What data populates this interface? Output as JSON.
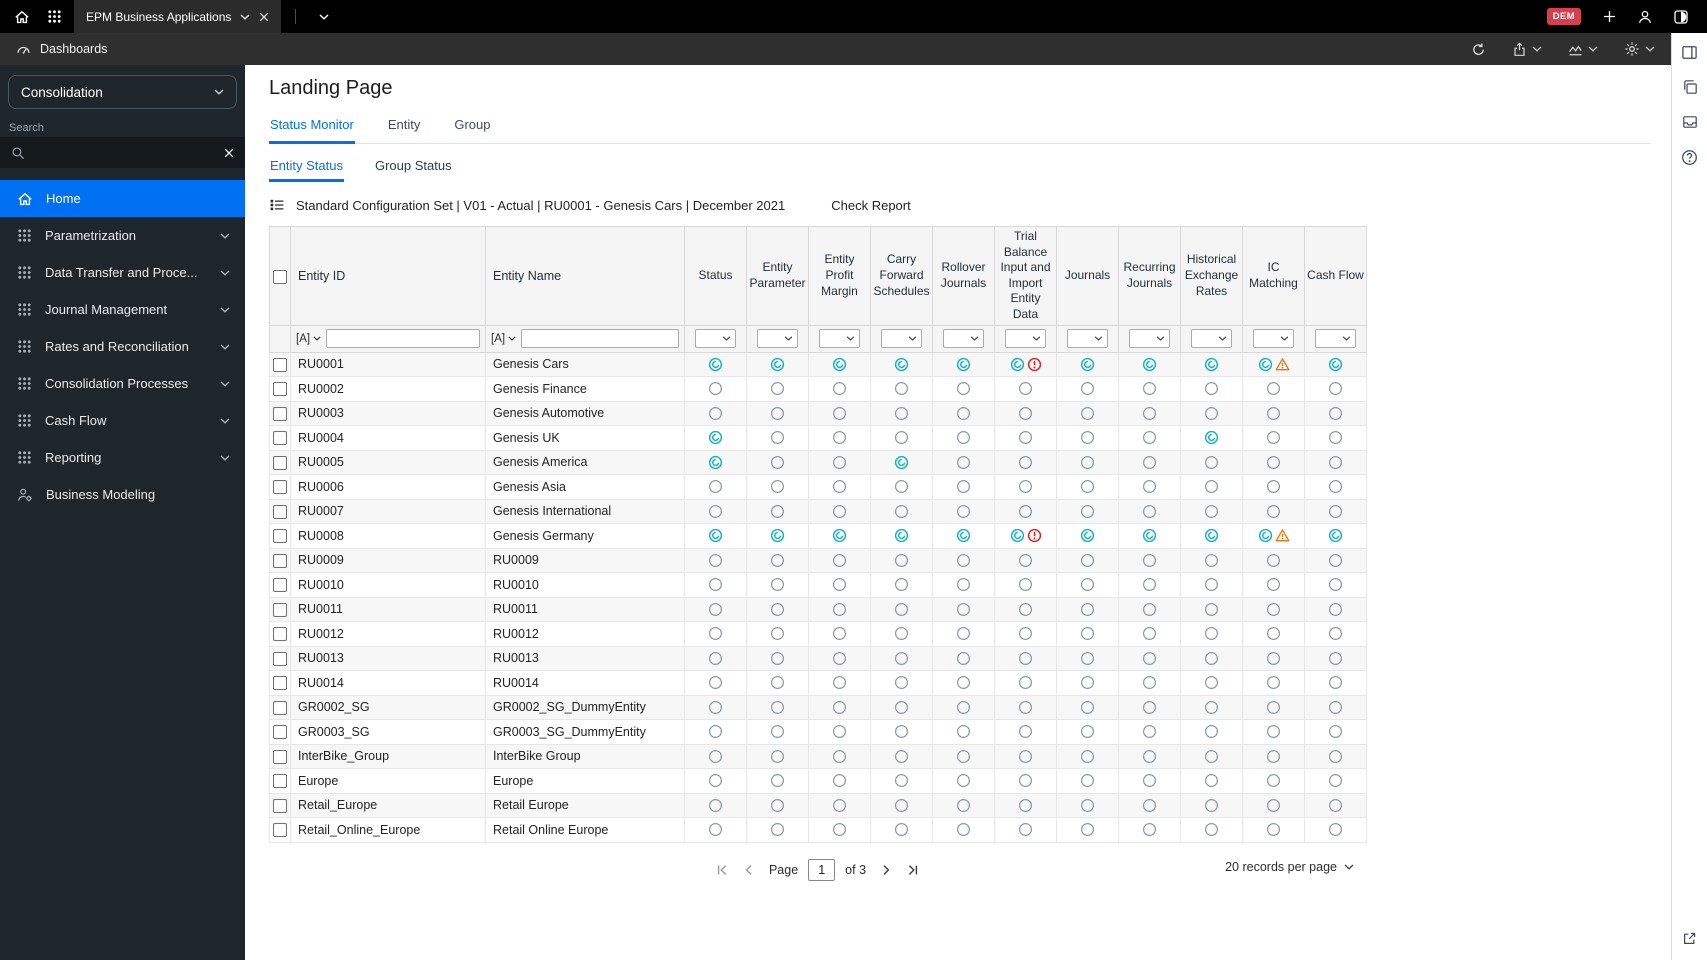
{
  "topbar": {
    "tab_label": "EPM Business Applications",
    "badge": "DEM"
  },
  "subbar": {
    "title": "Dashboards",
    "actions": [
      {
        "icon": "refresh",
        "chevron": false
      },
      {
        "icon": "share",
        "chevron": true
      },
      {
        "icon": "insights",
        "chevron": true
      },
      {
        "icon": "settings",
        "chevron": true
      }
    ]
  },
  "right_rail": {
    "top_icons": [
      "panel-layout",
      "copy",
      "inbox",
      "help"
    ],
    "bottom_icon": "open-external"
  },
  "sidebar": {
    "module_selector": "Consolidation",
    "search_label": "Search",
    "items": [
      {
        "label": "Home",
        "icon": "home",
        "active": true,
        "chevron": false
      },
      {
        "label": "Parametrization",
        "icon": "grid",
        "active": false,
        "chevron": true
      },
      {
        "label": "Data Transfer and Proce...",
        "icon": "grid",
        "active": false,
        "chevron": true
      },
      {
        "label": "Journal Management",
        "icon": "grid",
        "active": false,
        "chevron": true
      },
      {
        "label": "Rates and Reconciliation",
        "icon": "grid",
        "active": false,
        "chevron": true
      },
      {
        "label": "Consolidation Processes",
        "icon": "grid",
        "active": false,
        "chevron": true
      },
      {
        "label": "Cash Flow",
        "icon": "grid",
        "active": false,
        "chevron": true
      },
      {
        "label": "Reporting",
        "icon": "grid",
        "active": false,
        "chevron": true
      },
      {
        "label": "Business Modeling",
        "icon": "user-gear",
        "active": false,
        "chevron": false
      }
    ]
  },
  "main": {
    "title": "Landing Page",
    "tabs": [
      {
        "label": "Status Monitor",
        "active": true
      },
      {
        "label": "Entity",
        "active": false
      },
      {
        "label": "Group",
        "active": false
      }
    ],
    "subtabs": [
      {
        "label": "Entity Status",
        "active": true
      },
      {
        "label": "Group Status",
        "active": false
      }
    ],
    "context": "Standard Configuration Set | V01 - Actual | RU0001 - Genesis Cars | December 2021",
    "check_report": "Check Report",
    "table": {
      "id_header": "Entity ID",
      "name_header": "Entity Name",
      "filter_prefix": "[A]",
      "status_columns": [
        "Status",
        "Entity Parameter",
        "Entity Profit Margin",
        "Carry Forward Schedules",
        "Rollover Journals",
        "Trial Balance Input and Import Entity Data",
        "Journals",
        "Recurring Journals",
        "Historical Exchange Rates",
        "IC Matching",
        "Cash Flow"
      ],
      "rows": [
        {
          "id": "RU0001",
          "name": "Genesis Cars",
          "statuses": [
            "done",
            "done",
            "done",
            "done",
            "done",
            "done-error",
            "done",
            "done",
            "done",
            "done-warning",
            "done"
          ]
        },
        {
          "id": "RU0002",
          "name": "Genesis Finance",
          "statuses": [
            "none",
            "none",
            "none",
            "none",
            "none",
            "none",
            "none",
            "none",
            "none",
            "none",
            "none"
          ]
        },
        {
          "id": "RU0003",
          "name": "Genesis Automotive",
          "statuses": [
            "none",
            "none",
            "none",
            "none",
            "none",
            "none",
            "none",
            "none",
            "none",
            "none",
            "none"
          ]
        },
        {
          "id": "RU0004",
          "name": "Genesis UK",
          "statuses": [
            "done",
            "none",
            "none",
            "none",
            "none",
            "none",
            "none",
            "none",
            "done",
            "none",
            "none"
          ]
        },
        {
          "id": "RU0005",
          "name": "Genesis America",
          "statuses": [
            "done",
            "none",
            "none",
            "done",
            "none",
            "none",
            "none",
            "none",
            "none",
            "none",
            "none"
          ]
        },
        {
          "id": "RU0006",
          "name": "Genesis Asia",
          "statuses": [
            "none",
            "none",
            "none",
            "none",
            "none",
            "none",
            "none",
            "none",
            "none",
            "none",
            "none"
          ]
        },
        {
          "id": "RU0007",
          "name": "Genesis International",
          "statuses": [
            "none",
            "none",
            "none",
            "none",
            "none",
            "none",
            "none",
            "none",
            "none",
            "none",
            "none"
          ]
        },
        {
          "id": "RU0008",
          "name": "Genesis Germany",
          "statuses": [
            "done",
            "done",
            "done",
            "done",
            "done",
            "done-error",
            "done",
            "done",
            "done",
            "done-warning",
            "done"
          ]
        },
        {
          "id": "RU0009",
          "name": "RU0009",
          "statuses": [
            "none",
            "none",
            "none",
            "none",
            "none",
            "none",
            "none",
            "none",
            "none",
            "none",
            "none"
          ]
        },
        {
          "id": "RU0010",
          "name": "RU0010",
          "statuses": [
            "none",
            "none",
            "none",
            "none",
            "none",
            "none",
            "none",
            "none",
            "none",
            "none",
            "none"
          ]
        },
        {
          "id": "RU0011",
          "name": "RU0011",
          "statuses": [
            "none",
            "none",
            "none",
            "none",
            "none",
            "none",
            "none",
            "none",
            "none",
            "none",
            "none"
          ]
        },
        {
          "id": "RU0012",
          "name": "RU0012",
          "statuses": [
            "none",
            "none",
            "none",
            "none",
            "none",
            "none",
            "none",
            "none",
            "none",
            "none",
            "none"
          ]
        },
        {
          "id": "RU0013",
          "name": "RU0013",
          "statuses": [
            "none",
            "none",
            "none",
            "none",
            "none",
            "none",
            "none",
            "none",
            "none",
            "none",
            "none"
          ]
        },
        {
          "id": "RU0014",
          "name": "RU0014",
          "statuses": [
            "none",
            "none",
            "none",
            "none",
            "none",
            "none",
            "none",
            "none",
            "none",
            "none",
            "none"
          ]
        },
        {
          "id": "GR0002_SG",
          "name": "GR0002_SG_DummyEntity",
          "statuses": [
            "none",
            "none",
            "none",
            "none",
            "none",
            "none",
            "none",
            "none",
            "none",
            "none",
            "none"
          ]
        },
        {
          "id": "GR0003_SG",
          "name": "GR0003_SG_DummyEntity",
          "statuses": [
            "none",
            "none",
            "none",
            "none",
            "none",
            "none",
            "none",
            "none",
            "none",
            "none",
            "none"
          ]
        },
        {
          "id": "InterBike_Group",
          "name": "InterBike Group",
          "statuses": [
            "none",
            "none",
            "none",
            "none",
            "none",
            "none",
            "none",
            "none",
            "none",
            "none",
            "none"
          ]
        },
        {
          "id": "Europe",
          "name": "Europe",
          "statuses": [
            "none",
            "none",
            "none",
            "none",
            "none",
            "none",
            "none",
            "none",
            "none",
            "none",
            "none"
          ]
        },
        {
          "id": "Retail_Europe",
          "name": "Retail Europe",
          "statuses": [
            "none",
            "none",
            "none",
            "none",
            "none",
            "none",
            "none",
            "none",
            "none",
            "none",
            "none"
          ]
        },
        {
          "id": "Retail_Online_Europe",
          "name": "Retail Online Europe",
          "statuses": [
            "none",
            "none",
            "none",
            "none",
            "none",
            "none",
            "none",
            "none",
            "none",
            "none",
            "none"
          ]
        }
      ]
    },
    "pagination": {
      "page_label": "Page",
      "current_page": "1",
      "total_label": "of 3",
      "per_page": "20 records per page"
    }
  },
  "colors": {
    "accent-blue": "#0070f2",
    "status-teal": "#0fb3c2",
    "error-red": "#dc1e1e",
    "warning-orange": "#e9730c",
    "badge-red": "#d5404e"
  }
}
